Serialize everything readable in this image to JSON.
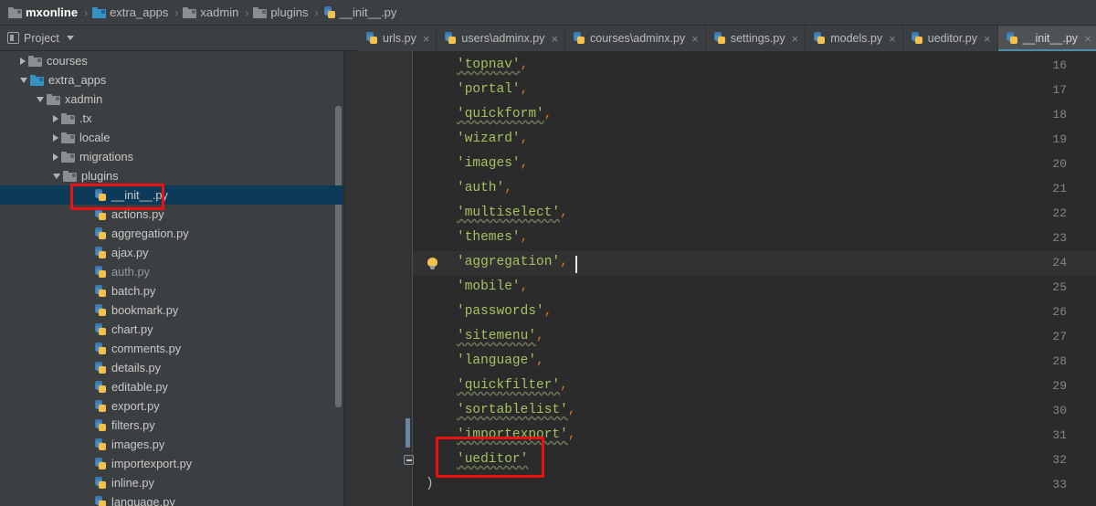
{
  "breadcrumb": {
    "name": "breadcrumb",
    "separator": "›",
    "items": [
      {
        "label": "mxonline",
        "icon": "folder-icon",
        "kind": "folder-gray",
        "root": true
      },
      {
        "label": "extra_apps",
        "icon": "folder-blue-icon",
        "kind": "folder-blue",
        "root": false
      },
      {
        "label": "xadmin",
        "icon": "folder-icon",
        "kind": "folder-gray",
        "root": false
      },
      {
        "label": "plugins",
        "icon": "folder-icon",
        "kind": "folder-gray",
        "root": false
      },
      {
        "label": "__init__.py",
        "icon": "python-file-icon",
        "kind": "py",
        "root": false
      }
    ]
  },
  "toolbar": {
    "project_label": "Project",
    "dropdown_caret": "caret-down-icon",
    "icons": [
      {
        "name": "history-clock-icon",
        "title": "clock"
      },
      {
        "name": "collapse-all-icon",
        "title": "collapse"
      },
      {
        "name": "settings-gear-icon",
        "title": "gear"
      },
      {
        "name": "locate-file-icon",
        "title": "locate"
      }
    ]
  },
  "tabs": {
    "close_glyph": "×",
    "items": [
      {
        "label": "urls.py",
        "active": false
      },
      {
        "label": "users\\adminx.py",
        "active": false
      },
      {
        "label": "courses\\adminx.py",
        "active": false
      },
      {
        "label": "settings.py",
        "active": false
      },
      {
        "label": "models.py",
        "active": false
      },
      {
        "label": "ueditor.py",
        "active": false
      },
      {
        "label": "__init__.py",
        "active": true
      }
    ]
  },
  "tree": {
    "rows": [
      {
        "label": "courses",
        "indent": 22,
        "toggle": "closed",
        "icon": "folder-gray",
        "selected": false,
        "dim": false
      },
      {
        "label": "extra_apps",
        "indent": 22,
        "toggle": "open",
        "icon": "folder-blue",
        "selected": false,
        "dim": false
      },
      {
        "label": "xadmin",
        "indent": 40,
        "toggle": "open",
        "icon": "folder-gray",
        "selected": false,
        "dim": false
      },
      {
        "label": ".tx",
        "indent": 58,
        "toggle": "closed",
        "icon": "folder-gray",
        "selected": false,
        "dim": false
      },
      {
        "label": "locale",
        "indent": 58,
        "toggle": "closed",
        "icon": "folder-gray",
        "selected": false,
        "dim": false
      },
      {
        "label": "migrations",
        "indent": 58,
        "toggle": "closed",
        "icon": "folder-gray",
        "selected": false,
        "dim": false
      },
      {
        "label": "plugins",
        "indent": 58,
        "toggle": "open",
        "icon": "folder-gray",
        "selected": false,
        "dim": false
      },
      {
        "label": "__init__.py",
        "indent": 94,
        "toggle": "none",
        "icon": "py",
        "selected": true,
        "dim": false
      },
      {
        "label": "actions.py",
        "indent": 94,
        "toggle": "none",
        "icon": "py",
        "selected": false,
        "dim": false
      },
      {
        "label": "aggregation.py",
        "indent": 94,
        "toggle": "none",
        "icon": "py",
        "selected": false,
        "dim": false
      },
      {
        "label": "ajax.py",
        "indent": 94,
        "toggle": "none",
        "icon": "py",
        "selected": false,
        "dim": false
      },
      {
        "label": "auth.py",
        "indent": 94,
        "toggle": "none",
        "icon": "py",
        "selected": false,
        "dim": true
      },
      {
        "label": "batch.py",
        "indent": 94,
        "toggle": "none",
        "icon": "py",
        "selected": false,
        "dim": false
      },
      {
        "label": "bookmark.py",
        "indent": 94,
        "toggle": "none",
        "icon": "py",
        "selected": false,
        "dim": false
      },
      {
        "label": "chart.py",
        "indent": 94,
        "toggle": "none",
        "icon": "py",
        "selected": false,
        "dim": false
      },
      {
        "label": "comments.py",
        "indent": 94,
        "toggle": "none",
        "icon": "py",
        "selected": false,
        "dim": false
      },
      {
        "label": "details.py",
        "indent": 94,
        "toggle": "none",
        "icon": "py",
        "selected": false,
        "dim": false
      },
      {
        "label": "editable.py",
        "indent": 94,
        "toggle": "none",
        "icon": "py",
        "selected": false,
        "dim": false
      },
      {
        "label": "export.py",
        "indent": 94,
        "toggle": "none",
        "icon": "py",
        "selected": false,
        "dim": false
      },
      {
        "label": "filters.py",
        "indent": 94,
        "toggle": "none",
        "icon": "py",
        "selected": false,
        "dim": false
      },
      {
        "label": "images.py",
        "indent": 94,
        "toggle": "none",
        "icon": "py",
        "selected": false,
        "dim": false
      },
      {
        "label": "importexport.py",
        "indent": 94,
        "toggle": "none",
        "icon": "py",
        "selected": false,
        "dim": false
      },
      {
        "label": "inline.py",
        "indent": 94,
        "toggle": "none",
        "icon": "py",
        "selected": false,
        "dim": false
      },
      {
        "label": "language.py",
        "indent": 94,
        "toggle": "none",
        "icon": "py",
        "selected": false,
        "dim": false
      }
    ]
  },
  "editor": {
    "first_line_number": 16,
    "current_line_number": 24,
    "lines": [
      {
        "n": 16,
        "text": "'topnav',",
        "string": "'topnav'",
        "comma": ",",
        "spell": true,
        "kind": "string"
      },
      {
        "n": 17,
        "text": "'portal',",
        "string": "'portal'",
        "comma": ",",
        "spell": false,
        "kind": "string"
      },
      {
        "n": 18,
        "text": "'quickform',",
        "string": "'quickform'",
        "comma": ",",
        "spell": true,
        "kind": "string"
      },
      {
        "n": 19,
        "text": "'wizard',",
        "string": "'wizard'",
        "comma": ",",
        "spell": false,
        "kind": "string"
      },
      {
        "n": 20,
        "text": "'images',",
        "string": "'images'",
        "comma": ",",
        "spell": false,
        "kind": "string"
      },
      {
        "n": 21,
        "text": "'auth',",
        "string": "'auth'",
        "comma": ",",
        "spell": false,
        "kind": "string"
      },
      {
        "n": 22,
        "text": "'multiselect',",
        "string": "'multiselect'",
        "comma": ",",
        "spell": true,
        "kind": "string"
      },
      {
        "n": 23,
        "text": "'themes',",
        "string": "'themes'",
        "comma": ",",
        "spell": false,
        "kind": "string"
      },
      {
        "n": 24,
        "text": "'aggregation',",
        "string": "'aggregation'",
        "comma": ",",
        "spell": false,
        "kind": "string"
      },
      {
        "n": 25,
        "text": "'mobile',",
        "string": "'mobile'",
        "comma": ",",
        "spell": false,
        "kind": "string"
      },
      {
        "n": 26,
        "text": "'passwords',",
        "string": "'passwords'",
        "comma": ",",
        "spell": false,
        "kind": "string"
      },
      {
        "n": 27,
        "text": "'sitemenu',",
        "string": "'sitemenu'",
        "comma": ",",
        "spell": true,
        "kind": "string"
      },
      {
        "n": 28,
        "text": "'language',",
        "string": "'language'",
        "comma": ",",
        "spell": false,
        "kind": "string"
      },
      {
        "n": 29,
        "text": "'quickfilter',",
        "string": "'quickfilter'",
        "comma": ",",
        "spell": true,
        "kind": "string"
      },
      {
        "n": 30,
        "text": "'sortablelist',",
        "string": "'sortablelist'",
        "comma": ",",
        "spell": true,
        "kind": "string"
      },
      {
        "n": 31,
        "text": "'importexport',",
        "string": "'importexport'",
        "comma": ",",
        "spell": true,
        "kind": "string"
      },
      {
        "n": 32,
        "text": "'ueditor'",
        "string": "'ueditor'",
        "comma": "",
        "spell": true,
        "kind": "string"
      },
      {
        "n": 33,
        "text": ")",
        "string": "",
        "comma": "",
        "spell": false,
        "kind": "paren"
      }
    ],
    "intention_bulb": {
      "name": "intention-bulb-icon",
      "line": 24
    },
    "caret": {
      "line": 24,
      "after": "'aggregation',"
    }
  },
  "annotations": [
    {
      "name": "annotation-init-file",
      "target": "__init__.py tree row"
    },
    {
      "name": "annotation-ueditor-line",
      "target": "'ueditor' code line"
    }
  ],
  "colors": {
    "editor_bg": "#2b2b2b",
    "panel_bg": "#3c3f41",
    "gutter_bg": "#313335",
    "selection_blue": "#0d3a58",
    "string_green": "#a5c261",
    "punct_orange": "#cc7832",
    "annotation_red": "#ee1111",
    "active_tab_underline": "#4a8fa8"
  }
}
